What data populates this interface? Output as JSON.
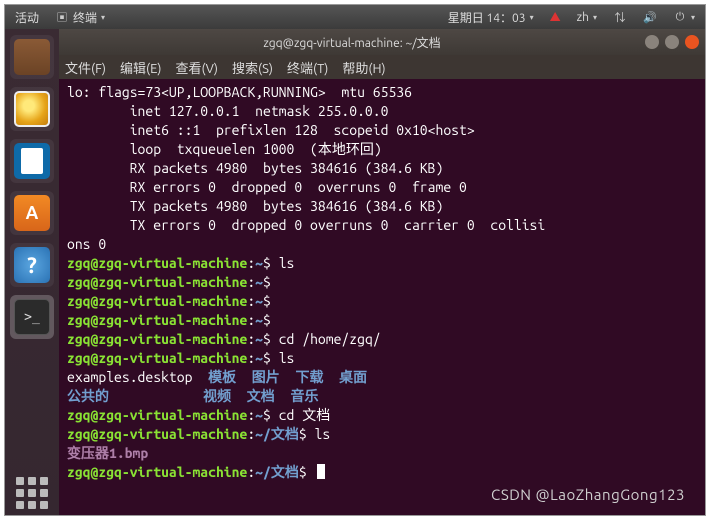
{
  "panel": {
    "activities": "活动",
    "app_menu": "终端",
    "clock": "星期日 14：03",
    "lang": "zh"
  },
  "launcher": {
    "items": [
      "files",
      "rhythmbox",
      "writer",
      "software",
      "help",
      "terminal",
      "apps"
    ]
  },
  "window": {
    "title": "zgq@zgq-virtual-machine: ~/文档",
    "menus": {
      "file": "文件(F)",
      "edit": "编辑(E)",
      "view": "查看(V)",
      "search": "搜索(S)",
      "terminal": "终端(T)",
      "help": "帮助(H)"
    }
  },
  "term": {
    "lo1": "lo: flags=73<UP,LOOPBACK,RUNNING>  mtu 65536",
    "lo2": "        inet 127.0.0.1  netmask 255.0.0.0",
    "lo3": "        inet6 ::1  prefixlen 128  scopeid 0x10<host>",
    "lo4": "        loop  txqueuelen 1000  (本地环回)",
    "lo5": "        RX packets 4980  bytes 384616 (384.6 KB)",
    "lo6": "        RX errors 0  dropped 0  overruns 0  frame 0",
    "lo7": "        TX packets 4980  bytes 384616 (384.6 KB)",
    "lo8": "        TX errors 0  dropped 0 overruns 0  carrier 0  collisi",
    "lo9": "ons 0",
    "prompt_home": "zgq@zgq-virtual-machine",
    "path_home": "~",
    "path_doc": "~/文档",
    "dollar": "$ ",
    "cmd_ls": "ls",
    "cmd_cd_home": "cd /home/zgq/",
    "cmd_cd_doc": "cd 文档",
    "ls_home_r1a": "examples.desktop  ",
    "ls_home_r1b": "模板  图片  下载  桌面",
    "ls_home_r2a": "公共的            ",
    "ls_home_r2b": "视频  文档  音乐",
    "ls_doc": "变压器1.bmp"
  },
  "watermark": "CSDN @LaoZhangGong123"
}
